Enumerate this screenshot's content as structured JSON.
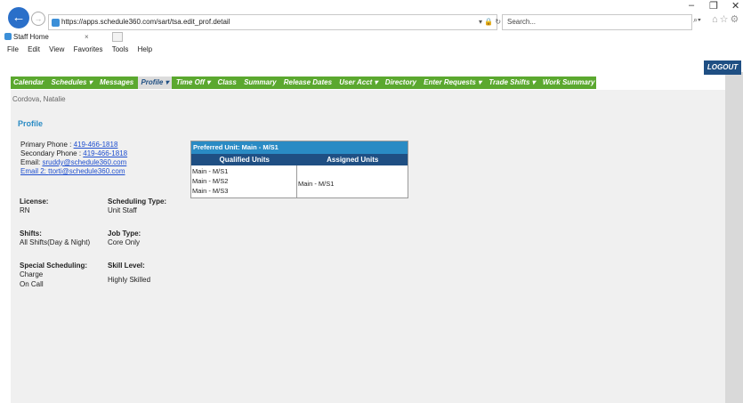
{
  "browser": {
    "url": "https://apps.schedule360.com/sart/tsa.edit_prof.detail",
    "url_tools": "▾ 🔒 ↻",
    "search_placeholder": "Search...",
    "search_glyph": "⌕▾",
    "right_icons": "⌂☆⚙",
    "minimize": "–",
    "restore": "❐",
    "close": "✕",
    "back_icon": "←",
    "forward_icon": "→",
    "tab_title": "Staff Home",
    "tab_close": "×",
    "menu": [
      "File",
      "Edit",
      "View",
      "Favorites",
      "Tools",
      "Help"
    ]
  },
  "app": {
    "logout_label": "LOGOUT",
    "nav": [
      {
        "label": "Calendar",
        "active": false
      },
      {
        "label": "Schedules ▾",
        "active": false
      },
      {
        "label": "Messages",
        "active": false
      },
      {
        "label": "Profile ▾",
        "active": true
      },
      {
        "label": "Time Off ▾",
        "active": false
      },
      {
        "label": "Class",
        "active": false
      },
      {
        "label": "Summary",
        "active": false
      },
      {
        "label": "Release Dates",
        "active": false
      },
      {
        "label": "User Acct ▾",
        "active": false
      },
      {
        "label": "Directory",
        "active": false
      },
      {
        "label": "Enter Requests ▾",
        "active": false
      },
      {
        "label": "Trade Shifts ▾",
        "active": false
      },
      {
        "label": "Work Summary",
        "active": false
      }
    ],
    "user_name": "Cordova, Natalie",
    "section_title": "Profile",
    "contact": {
      "primary_label": "Primary Phone : ",
      "primary_value": "419-466-1818",
      "secondary_label": "Secondary Phone : ",
      "secondary_value": "419-466-1818",
      "email_label": "Email: ",
      "email_value": "sruddy@schedule360.com",
      "email2_label": "Email 2: ",
      "email2_value": "ttorti@schedule360.com"
    },
    "fields": {
      "license_label": "License:",
      "license_value": "RN",
      "sched_type_label": "Scheduling Type:",
      "sched_type_value": "Unit Staff",
      "shifts_label": "Shifts:",
      "shifts_value": "All Shifts(Day & Night)",
      "job_type_label": "Job Type:",
      "job_type_value": "Core Only",
      "special_label": "Special Scheduling:",
      "special_value_1": "Charge",
      "special_value_2": "On Call",
      "skill_label": "Skill Level:",
      "skill_value": "Highly Skilled"
    },
    "units": {
      "preferred": "Preferred Unit: Main - M/S1",
      "qualified_header": "Qualified Units",
      "assigned_header": "Assigned Units",
      "qualified": [
        "Main - M/S1",
        "Main - M/S2",
        "Main - M/S3"
      ],
      "assigned": [
        "Main - M/S1"
      ]
    }
  },
  "colors": {
    "nav_green": "#5ba82f",
    "logout_blue": "#1f4f83",
    "section_blue": "#2a8bc4",
    "content_bg": "#f0f0f0"
  }
}
